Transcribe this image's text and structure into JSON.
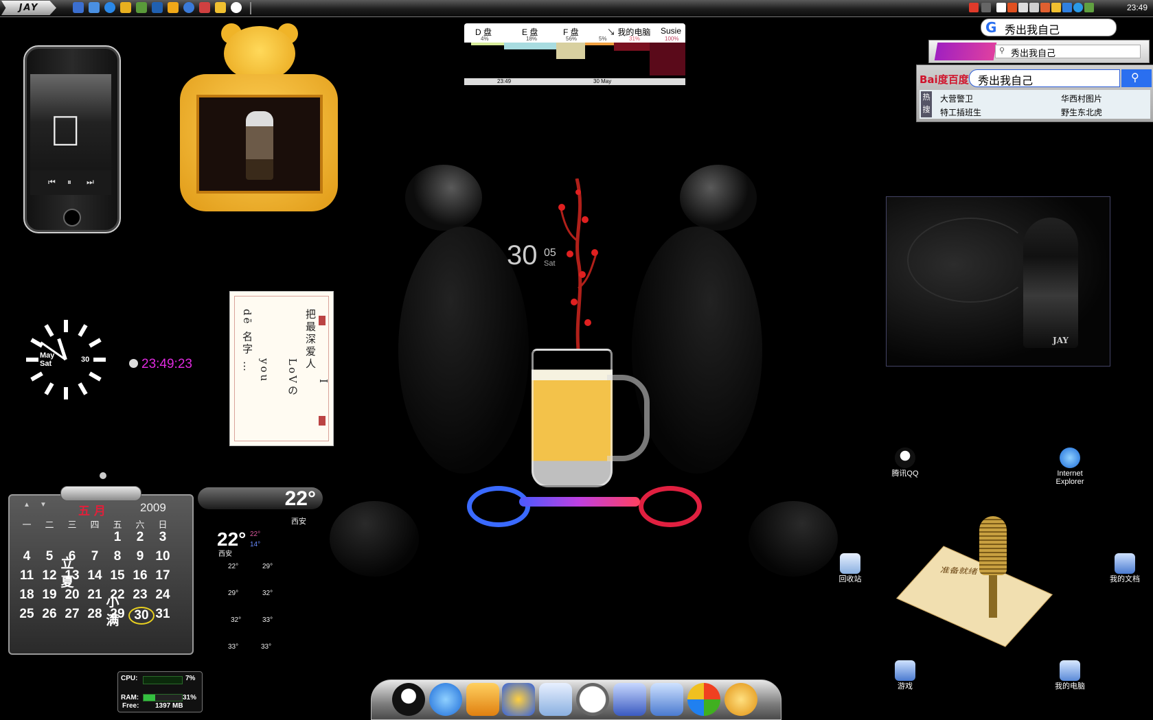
{
  "taskbar": {
    "start_label": "JAY",
    "clock": "23:49",
    "quick_launch": [
      "ie-icon",
      "desktop-icon",
      "ie-icon",
      "folder-icon",
      "media-icon",
      "outlook-icon",
      "shield-icon",
      "globe-icon",
      "tool-icon",
      "chat-icon",
      "qq-icon"
    ],
    "tray": [
      "s-icon",
      "chevron-icon",
      "window-icon",
      "ime-icon",
      "mode-icon",
      "speaker-icon",
      "network-icon",
      "shield-icon",
      "update-icon",
      "ie-icon",
      "tray-app-icon"
    ]
  },
  "drives": {
    "headers": [
      "D 盘",
      "E 盘",
      "F 盘",
      "↘ 我的电脑",
      "Susie"
    ],
    "percents": [
      "4%",
      "18%",
      "56%",
      "5%",
      "31%",
      "100%"
    ],
    "footer_time": "23:49",
    "footer_date": "30 May"
  },
  "google": {
    "query": "秀出我自己"
  },
  "logo_search": {
    "query": "秀出我自己"
  },
  "baidu": {
    "logo": "Bai度百度",
    "query": "秀出我自己",
    "hot_tag": "热搜",
    "hot": [
      "大营警卫",
      "华西村图片",
      "特工插班生",
      "野生东北虎"
    ]
  },
  "photo": {
    "signature": "JAY"
  },
  "analog_clock": {
    "month": "May",
    "weekday": "Sat",
    "day": "30"
  },
  "digital_clock": {
    "time": "23:49:23"
  },
  "poem": {
    "columns": [
      "把最深爱人",
      "I",
      "LoVの",
      "you",
      "dē 名字 …"
    ]
  },
  "center_date": {
    "day": "30",
    "month": "05",
    "weekday": "Sat"
  },
  "calendar": {
    "month": "五 月",
    "year": "2009",
    "weekdays": [
      "一",
      "二",
      "三",
      "四",
      "五",
      "六",
      "日"
    ],
    "weeks": [
      [
        "",
        "",
        "",
        "",
        "1",
        "2",
        "3"
      ],
      [
        "4",
        "5",
        "6",
        "7",
        "8",
        "9",
        "10"
      ],
      [
        "11",
        "12",
        "13",
        "14",
        "15",
        "16",
        "17"
      ],
      [
        "18",
        "19",
        "20",
        "21",
        "22",
        "23",
        "24"
      ],
      [
        "25",
        "26",
        "27",
        "28",
        "29",
        "30",
        "31"
      ]
    ],
    "today": "30",
    "minor_labels": {
      "立夏": "5",
      "小满": "21"
    }
  },
  "weather": {
    "bar_temp": "22°",
    "bar_city": "西安",
    "main_temp": "22°",
    "high": "22°",
    "low": "14°",
    "city": "西安",
    "forecast": [
      [
        "22°",
        "29°"
      ],
      [
        "29°",
        "32°"
      ],
      [
        "32°",
        "33°"
      ],
      [
        "33°",
        "33°"
      ]
    ]
  },
  "cpu_meter": {
    "cpu_label": "CPU:",
    "cpu_value": "7%",
    "ram_label": "RAM:",
    "ram_value": "31%",
    "ram_fraction": 0.31,
    "free_label": "Free:",
    "free_value": "1397 MB"
  },
  "desktop_icons": {
    "qq": "腾讯QQ",
    "ie_line1": "Internet",
    "ie_line2": "Explorer",
    "recycle": "回收站",
    "docs": "我的文档",
    "games": "游戏",
    "computer": "我的电脑"
  },
  "mic_card": {
    "text": "准备就绪"
  },
  "dock": [
    "qq-penguin-icon",
    "ie-icon",
    "tools-icon",
    "star-icon",
    "recycle-bin-icon",
    "clock-icon",
    "monitor-icon",
    "folder-icon",
    "windows-logo-icon",
    "app-icon"
  ]
}
